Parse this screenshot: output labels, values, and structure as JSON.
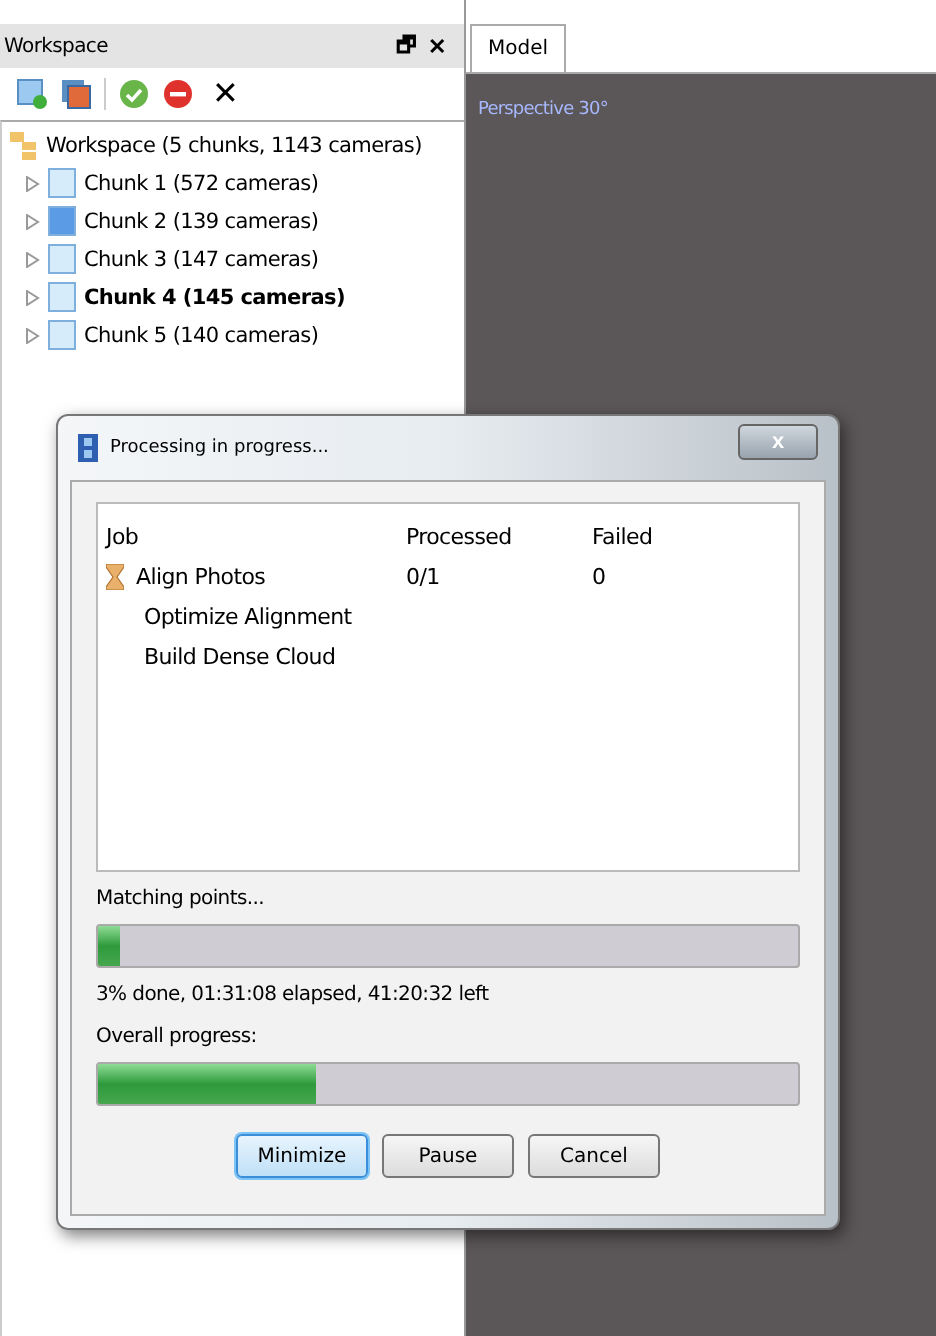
{
  "workspace_panel": {
    "title": "Workspace",
    "float_glyph": "🗗",
    "close_glyph": "✕",
    "toolbar_delete_glyph": "✕",
    "tree": {
      "label": "Workspace (5 chunks, 1143 cameras)",
      "children": [
        {
          "label": "Chunk 1 (572 cameras)",
          "expanded": false,
          "active": false,
          "selected": false
        },
        {
          "label": "Chunk 2 (139 cameras)",
          "expanded": false,
          "active": false,
          "selected": true
        },
        {
          "label": "Chunk 3 (147 cameras)",
          "expanded": false,
          "active": false,
          "selected": false
        },
        {
          "label": "Chunk 4 (145 cameras)",
          "expanded": false,
          "active": true,
          "selected": false
        },
        {
          "label": "Chunk 5 (140 cameras)",
          "expanded": false,
          "active": false,
          "selected": false
        }
      ]
    }
  },
  "model_panel": {
    "tabs": [
      {
        "label": "Model",
        "selected": true
      }
    ],
    "view_label": "Perspective 30°"
  },
  "dialog": {
    "title": "Processing in progress...",
    "close_glyph": "x",
    "columns": [
      "Job",
      "Processed",
      "Failed"
    ],
    "jobs": [
      {
        "name": "Align Photos",
        "processed": "0/1",
        "failed": "0",
        "running": true
      },
      {
        "name": "Optimize Alignment",
        "running": false
      },
      {
        "name": "Build Dense Cloud",
        "running": false
      }
    ],
    "stage_label": "Matching points...",
    "stage_progress": {
      "level": 0.03
    },
    "stage_status": "3% done, 01:31:08 elapsed, 41:20:32 left",
    "overall_label": "Overall progress:",
    "overall_progress": {
      "level": 0.31
    },
    "buttons": [
      {
        "label": "Minimize",
        "default": true
      },
      {
        "label": "Pause",
        "default": false
      },
      {
        "label": "Cancel",
        "default": false
      }
    ]
  }
}
